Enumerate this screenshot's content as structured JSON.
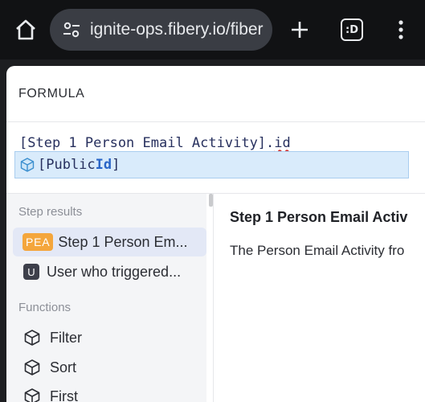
{
  "browser": {
    "url": "ignite-ops.fibery.io/fiber",
    "tabs_label": ":D"
  },
  "formula": {
    "title": "FORMULA",
    "code_prefix": "[Step 1 Person Email Activity].",
    "code_field": "id",
    "suggestion_prefix": "[Public ",
    "suggestion_match": "Id",
    "suggestion_suffix": "]"
  },
  "sidebar": {
    "step_results_label": "Step results",
    "step_results": [
      {
        "badge": "PEA",
        "label": "Step 1 Person Em..."
      },
      {
        "badge": "U",
        "label": "User who triggered..."
      }
    ],
    "functions_label": "Functions",
    "functions": [
      {
        "icon": "cube-icon",
        "label": "Filter"
      },
      {
        "icon": "cube-icon",
        "label": "Sort"
      },
      {
        "icon": "cube-icon",
        "label": "First"
      }
    ]
  },
  "detail": {
    "title": "Step 1 Person Email Activ",
    "description": "The Person Email Activity fro"
  },
  "colors": {
    "pea_badge": "#f4a63c",
    "user_badge": "#3d3f4a",
    "selection": "#e3e8f6",
    "suggestion": "#d9ebfb"
  }
}
